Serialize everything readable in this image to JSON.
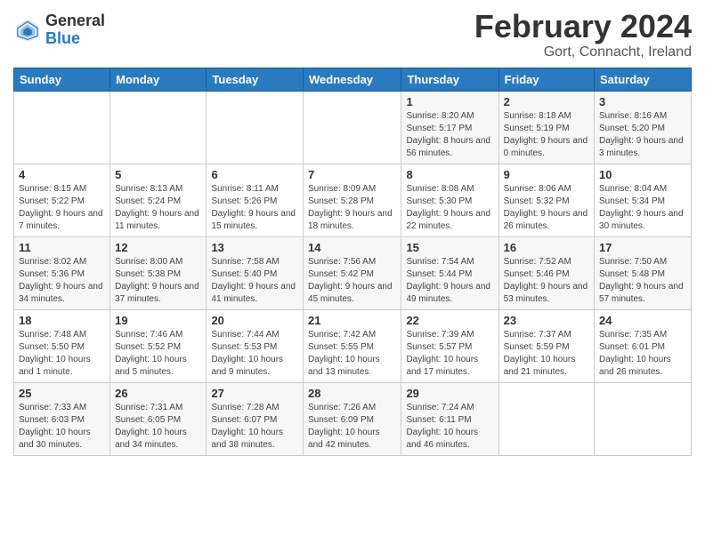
{
  "header": {
    "logo_general": "General",
    "logo_blue": "Blue",
    "month_title": "February 2024",
    "location": "Gort, Connacht, Ireland"
  },
  "days_of_week": [
    "Sunday",
    "Monday",
    "Tuesday",
    "Wednesday",
    "Thursday",
    "Friday",
    "Saturday"
  ],
  "weeks": [
    [
      {
        "day": "",
        "info": ""
      },
      {
        "day": "",
        "info": ""
      },
      {
        "day": "",
        "info": ""
      },
      {
        "day": "",
        "info": ""
      },
      {
        "day": "1",
        "info": "Sunrise: 8:20 AM\nSunset: 5:17 PM\nDaylight: 8 hours\nand 56 minutes."
      },
      {
        "day": "2",
        "info": "Sunrise: 8:18 AM\nSunset: 5:19 PM\nDaylight: 9 hours\nand 0 minutes."
      },
      {
        "day": "3",
        "info": "Sunrise: 8:16 AM\nSunset: 5:20 PM\nDaylight: 9 hours\nand 3 minutes."
      }
    ],
    [
      {
        "day": "4",
        "info": "Sunrise: 8:15 AM\nSunset: 5:22 PM\nDaylight: 9 hours\nand 7 minutes."
      },
      {
        "day": "5",
        "info": "Sunrise: 8:13 AM\nSunset: 5:24 PM\nDaylight: 9 hours\nand 11 minutes."
      },
      {
        "day": "6",
        "info": "Sunrise: 8:11 AM\nSunset: 5:26 PM\nDaylight: 9 hours\nand 15 minutes."
      },
      {
        "day": "7",
        "info": "Sunrise: 8:09 AM\nSunset: 5:28 PM\nDaylight: 9 hours\nand 18 minutes."
      },
      {
        "day": "8",
        "info": "Sunrise: 8:08 AM\nSunset: 5:30 PM\nDaylight: 9 hours\nand 22 minutes."
      },
      {
        "day": "9",
        "info": "Sunrise: 8:06 AM\nSunset: 5:32 PM\nDaylight: 9 hours\nand 26 minutes."
      },
      {
        "day": "10",
        "info": "Sunrise: 8:04 AM\nSunset: 5:34 PM\nDaylight: 9 hours\nand 30 minutes."
      }
    ],
    [
      {
        "day": "11",
        "info": "Sunrise: 8:02 AM\nSunset: 5:36 PM\nDaylight: 9 hours\nand 34 minutes."
      },
      {
        "day": "12",
        "info": "Sunrise: 8:00 AM\nSunset: 5:38 PM\nDaylight: 9 hours\nand 37 minutes."
      },
      {
        "day": "13",
        "info": "Sunrise: 7:58 AM\nSunset: 5:40 PM\nDaylight: 9 hours\nand 41 minutes."
      },
      {
        "day": "14",
        "info": "Sunrise: 7:56 AM\nSunset: 5:42 PM\nDaylight: 9 hours\nand 45 minutes."
      },
      {
        "day": "15",
        "info": "Sunrise: 7:54 AM\nSunset: 5:44 PM\nDaylight: 9 hours\nand 49 minutes."
      },
      {
        "day": "16",
        "info": "Sunrise: 7:52 AM\nSunset: 5:46 PM\nDaylight: 9 hours\nand 53 minutes."
      },
      {
        "day": "17",
        "info": "Sunrise: 7:50 AM\nSunset: 5:48 PM\nDaylight: 9 hours\nand 57 minutes."
      }
    ],
    [
      {
        "day": "18",
        "info": "Sunrise: 7:48 AM\nSunset: 5:50 PM\nDaylight: 10 hours\nand 1 minute."
      },
      {
        "day": "19",
        "info": "Sunrise: 7:46 AM\nSunset: 5:52 PM\nDaylight: 10 hours\nand 5 minutes."
      },
      {
        "day": "20",
        "info": "Sunrise: 7:44 AM\nSunset: 5:53 PM\nDaylight: 10 hours\nand 9 minutes."
      },
      {
        "day": "21",
        "info": "Sunrise: 7:42 AM\nSunset: 5:55 PM\nDaylight: 10 hours\nand 13 minutes."
      },
      {
        "day": "22",
        "info": "Sunrise: 7:39 AM\nSunset: 5:57 PM\nDaylight: 10 hours\nand 17 minutes."
      },
      {
        "day": "23",
        "info": "Sunrise: 7:37 AM\nSunset: 5:59 PM\nDaylight: 10 hours\nand 21 minutes."
      },
      {
        "day": "24",
        "info": "Sunrise: 7:35 AM\nSunset: 6:01 PM\nDaylight: 10 hours\nand 26 minutes."
      }
    ],
    [
      {
        "day": "25",
        "info": "Sunrise: 7:33 AM\nSunset: 6:03 PM\nDaylight: 10 hours\nand 30 minutes."
      },
      {
        "day": "26",
        "info": "Sunrise: 7:31 AM\nSunset: 6:05 PM\nDaylight: 10 hours\nand 34 minutes."
      },
      {
        "day": "27",
        "info": "Sunrise: 7:28 AM\nSunset: 6:07 PM\nDaylight: 10 hours\nand 38 minutes."
      },
      {
        "day": "28",
        "info": "Sunrise: 7:26 AM\nSunset: 6:09 PM\nDaylight: 10 hours\nand 42 minutes."
      },
      {
        "day": "29",
        "info": "Sunrise: 7:24 AM\nSunset: 6:11 PM\nDaylight: 10 hours\nand 46 minutes."
      },
      {
        "day": "",
        "info": ""
      },
      {
        "day": "",
        "info": ""
      }
    ]
  ]
}
